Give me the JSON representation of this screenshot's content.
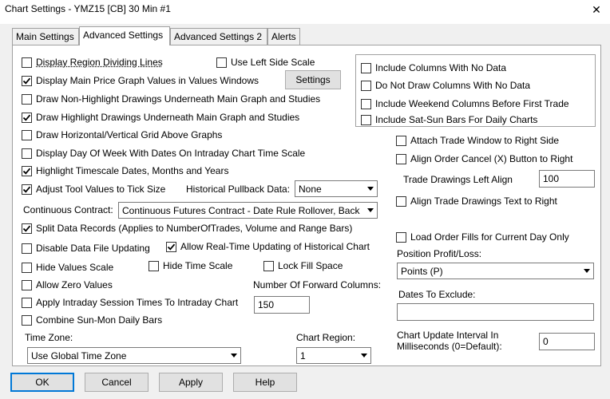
{
  "window": {
    "title": "Chart Settings - YMZ15 [CB]  30 Min   #1",
    "close_glyph": "✕"
  },
  "tabs": [
    {
      "label": "Main Settings",
      "active": false
    },
    {
      "label": "Advanced Settings",
      "active": true
    },
    {
      "label": "Advanced Settings 2",
      "active": false
    },
    {
      "label": "Alerts",
      "active": false
    }
  ],
  "left": {
    "display_region_dividing_lines": {
      "label": "Display Region Dividing Lines",
      "checked": false
    },
    "use_left_side_scale": {
      "label": "Use Left Side Scale",
      "checked": false
    },
    "display_main_price_values": {
      "label": "Display Main Price Graph Values in Values Windows",
      "checked": true
    },
    "settings_button": "Settings",
    "draw_non_highlight_underneath": {
      "label": "Draw Non-Highlight Drawings Underneath Main Graph and Studies",
      "checked": false
    },
    "draw_highlight_underneath": {
      "label": "Draw Highlight Drawings Underneath Main Graph and Studies",
      "checked": true
    },
    "draw_grid_above": {
      "label": "Draw Horizontal/Vertical Grid Above Graphs",
      "checked": false
    },
    "display_day_of_week": {
      "label": "Display Day Of Week With Dates On Intraday Chart Time Scale",
      "checked": false
    },
    "highlight_timescale": {
      "label": "Highlight Timescale Dates, Months and Years",
      "checked": true
    },
    "adjust_tool_values": {
      "label": "Adjust Tool Values to Tick Size",
      "checked": true
    },
    "historical_pullback_label": "Historical Pullback Data:",
    "historical_pullback_value": "None",
    "continuous_contract_label": "Continuous Contract:",
    "continuous_contract_value": "Continuous Futures Contract - Date Rule Rollover, Back",
    "split_data_records": {
      "label": "Split Data Records (Applies to NumberOfTrades, Volume and Range Bars)",
      "checked": true
    },
    "disable_data_file_updating": {
      "label": "Disable Data File Updating",
      "checked": false
    },
    "allow_realtime_updating": {
      "label": "Allow Real-Time Updating of Historical Chart",
      "checked": true
    },
    "hide_values_scale": {
      "label": "Hide Values Scale",
      "checked": false
    },
    "hide_time_scale": {
      "label": "Hide Time Scale",
      "checked": false
    },
    "lock_fill_space": {
      "label": "Lock Fill Space",
      "checked": false
    },
    "allow_zero_values": {
      "label": "Allow Zero Values",
      "checked": false
    },
    "number_forward_columns_label": "Number Of Forward Columns:",
    "number_forward_columns_value": "150",
    "apply_intraday_session_times": {
      "label": "Apply Intraday Session Times To Intraday Chart",
      "checked": false
    },
    "combine_sun_mon": {
      "label": "Combine Sun-Mon Daily Bars",
      "checked": false
    },
    "time_zone_label": "Time Zone:",
    "time_zone_value": "Use Global Time Zone",
    "chart_region_label": "Chart Region:",
    "chart_region_value": "1"
  },
  "right": {
    "include_columns_no_data": {
      "label": "Include Columns With No Data",
      "checked": false
    },
    "do_not_draw_columns_no_data": {
      "label": "Do Not Draw Columns With No Data",
      "checked": false
    },
    "include_weekend_columns": {
      "label": "Include Weekend Columns Before First Trade",
      "checked": false
    },
    "include_sat_sun_bars": {
      "label": "Include Sat-Sun Bars For Daily Charts",
      "checked": false
    },
    "attach_trade_window": {
      "label": "Attach Trade Window to Right Side",
      "checked": false
    },
    "align_order_cancel": {
      "label": "Align Order Cancel (X) Button to Right",
      "checked": false
    },
    "trade_drawings_left_align_label": "Trade Drawings Left Align",
    "trade_drawings_left_align_value": "100",
    "align_trade_drawings_text": {
      "label": "Align Trade Drawings Text to Right",
      "checked": false
    },
    "load_order_fills": {
      "label": "Load Order Fills for Current Day Only",
      "checked": false
    },
    "position_profit_loss_label": "Position Profit/Loss:",
    "position_profit_loss_value": "Points (P)",
    "dates_to_exclude_label": "Dates To Exclude:",
    "dates_to_exclude_value": "",
    "chart_update_interval_label_1": "Chart Update Interval In",
    "chart_update_interval_label_2": "Milliseconds (0=Default):",
    "chart_update_interval_value": "0"
  },
  "buttons": {
    "ok": "OK",
    "cancel": "Cancel",
    "apply": "Apply",
    "help": "Help"
  }
}
